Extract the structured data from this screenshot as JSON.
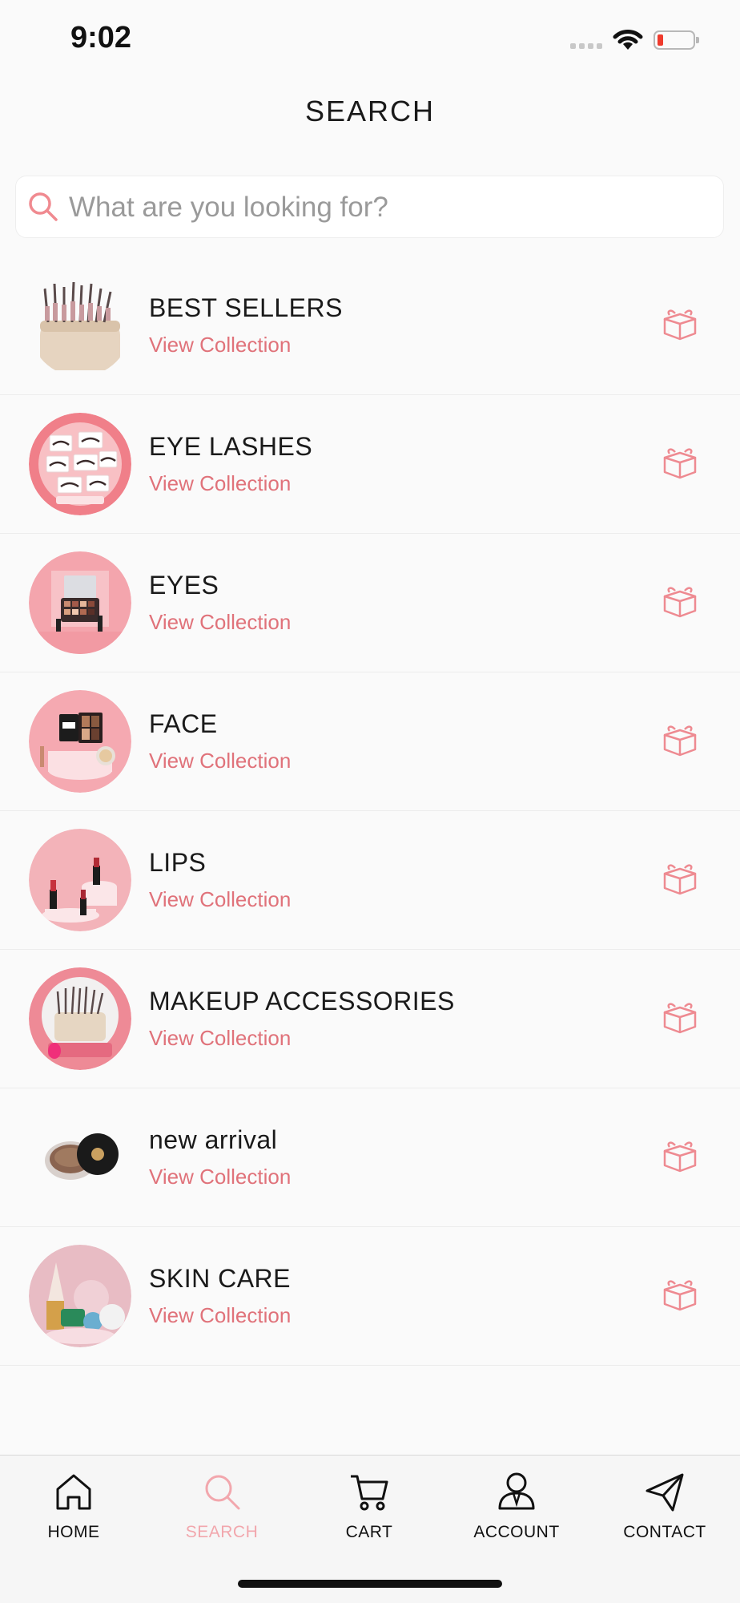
{
  "status_bar": {
    "time": "9:02"
  },
  "header": {
    "title": "SEARCH"
  },
  "search": {
    "placeholder": "What are you looking for?",
    "value": ""
  },
  "colors": {
    "accent": "#e0727a",
    "tab_active": "#f2a7ad"
  },
  "collections": [
    {
      "title": "BEST SELLERS",
      "subtitle": "View Collection",
      "icon": "gift-box-icon"
    },
    {
      "title": "EYE LASHES",
      "subtitle": "View Collection",
      "icon": "gift-box-icon"
    },
    {
      "title": "EYES",
      "subtitle": "View Collection",
      "icon": "gift-box-icon"
    },
    {
      "title": "FACE",
      "subtitle": "View Collection",
      "icon": "gift-box-icon"
    },
    {
      "title": "LIPS",
      "subtitle": "View Collection",
      "icon": "gift-box-icon"
    },
    {
      "title": "MAKEUP ACCESSORIES",
      "subtitle": "View Collection",
      "icon": "gift-box-icon"
    },
    {
      "title": "new arrival",
      "subtitle": "View Collection",
      "icon": "gift-box-icon"
    },
    {
      "title": "SKIN CARE",
      "subtitle": "View Collection",
      "icon": "gift-box-icon"
    }
  ],
  "tabs": [
    {
      "label": "HOME",
      "icon": "home-icon",
      "active": false
    },
    {
      "label": "SEARCH",
      "icon": "search-icon",
      "active": true
    },
    {
      "label": "CART",
      "icon": "cart-icon",
      "active": false
    },
    {
      "label": "ACCOUNT",
      "icon": "account-icon",
      "active": false
    },
    {
      "label": "CONTACT",
      "icon": "paper-plane-icon",
      "active": false
    }
  ]
}
